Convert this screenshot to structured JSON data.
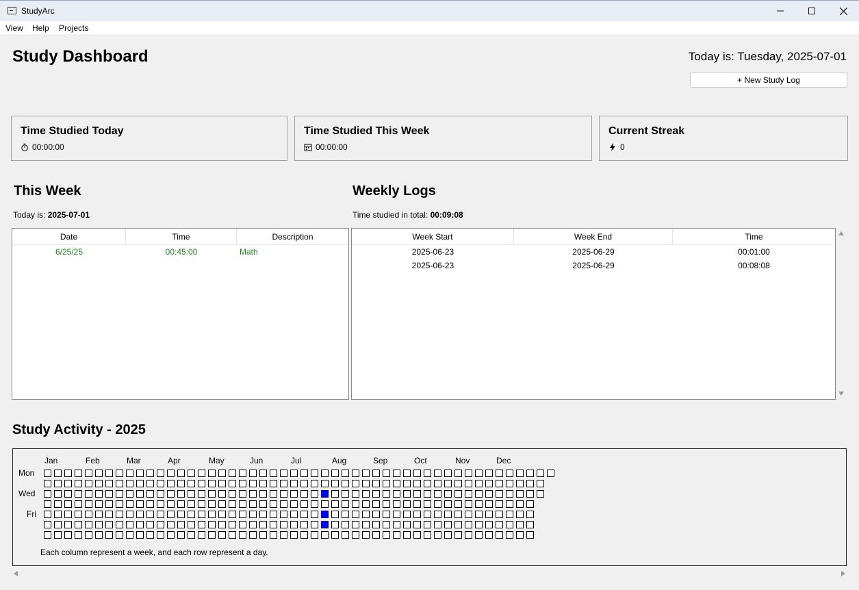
{
  "window": {
    "title": "StudyArc",
    "controls": [
      "minimize",
      "maximize",
      "close"
    ]
  },
  "menu": [
    "View",
    "Help",
    "Projects"
  ],
  "header": {
    "title": "Study Dashboard",
    "today_text": "Today is: Tuesday, 2025-07-01",
    "new_log_button": "+ New Study Log"
  },
  "cards": [
    {
      "title": "Time Studied Today",
      "icon": "stopwatch-icon",
      "value": "00:00:00"
    },
    {
      "title": "Time Studied This Week",
      "icon": "calendar-icon",
      "value": "00:00:00"
    },
    {
      "title": "Current Streak",
      "icon": "lightning-icon",
      "value": "0"
    }
  ],
  "this_week": {
    "title": "This Week",
    "today_label": "Today is:",
    "today_value": "2025-07-01",
    "columns": [
      "Date",
      "Time",
      "Description"
    ],
    "rows": [
      {
        "date": "6/25/25",
        "time": "00:45:00",
        "description": "Math"
      }
    ],
    "row_color": "#218a21"
  },
  "weekly_logs": {
    "title": "Weekly Logs",
    "total_label": "Time studied in total:",
    "total_value": "00:09:08",
    "columns": [
      "Week Start",
      "Week End",
      "Time"
    ],
    "rows": [
      {
        "start": "2025-06-23",
        "end": "2025-06-29",
        "time": "00:01:00"
      },
      {
        "start": "2025-06-23",
        "end": "2025-06-29",
        "time": "00:08:08"
      }
    ]
  },
  "activity": {
    "title": "Study Activity - 2025",
    "months": [
      "Jan",
      "Feb",
      "Mar",
      "Apr",
      "May",
      "Jun",
      "Jul",
      "Aug",
      "Sep",
      "Oct",
      "Nov",
      "Dec"
    ],
    "day_labels": [
      "Mon",
      "",
      "Wed",
      "",
      "Fri",
      "",
      ""
    ],
    "weeks_per_row": [
      50,
      49,
      49,
      48,
      48,
      48,
      48
    ],
    "active_cells": [
      {
        "week": 27,
        "day": 2
      },
      {
        "week": 27,
        "day": 4
      },
      {
        "week": 27,
        "day": 5
      }
    ],
    "active_color": "#0000ff",
    "legend": "Each column represent a week, and each row represent a day."
  }
}
